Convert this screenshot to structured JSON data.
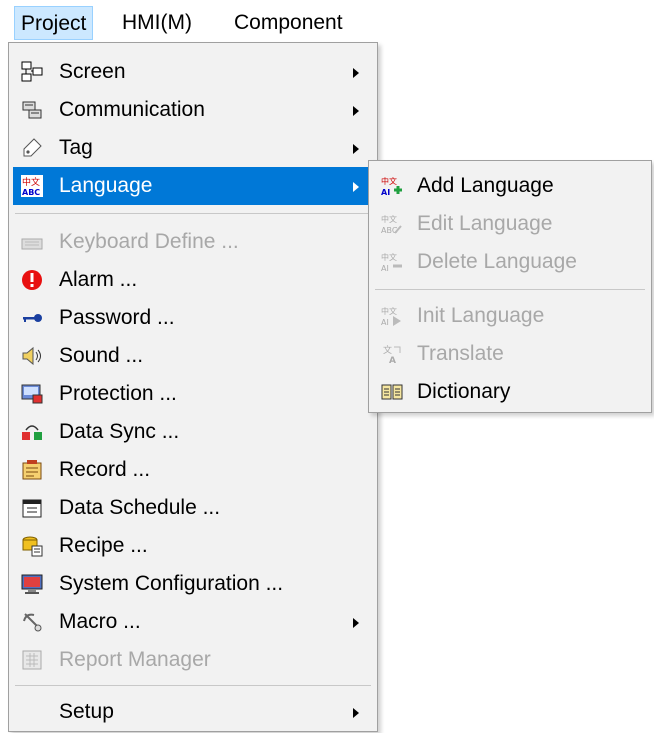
{
  "menubar": {
    "items": [
      {
        "label": "Project"
      },
      {
        "label": "HMI(M)"
      },
      {
        "label": "Component"
      }
    ]
  },
  "project_menu": {
    "items": [
      {
        "label": "Screen",
        "icon": "screen-icon",
        "submenu": true,
        "enabled": true
      },
      {
        "label": "Communication",
        "icon": "communication-icon",
        "submenu": true,
        "enabled": true
      },
      {
        "label": "Tag",
        "icon": "tag-icon",
        "submenu": true,
        "enabled": true
      },
      {
        "label": "Language",
        "icon": "language-icon",
        "submenu": true,
        "enabled": true,
        "selected": true
      },
      {
        "label": "Keyboard Define ...",
        "icon": "keyboard-icon",
        "submenu": false,
        "enabled": false
      },
      {
        "label": "Alarm ...",
        "icon": "alarm-icon",
        "submenu": false,
        "enabled": true
      },
      {
        "label": "Password ...",
        "icon": "key-icon",
        "submenu": false,
        "enabled": true
      },
      {
        "label": "Sound ...",
        "icon": "sound-icon",
        "submenu": false,
        "enabled": true
      },
      {
        "label": "Protection ...",
        "icon": "protection-icon",
        "submenu": false,
        "enabled": true
      },
      {
        "label": "Data Sync ...",
        "icon": "data-sync-icon",
        "submenu": false,
        "enabled": true
      },
      {
        "label": "Record ...",
        "icon": "record-icon",
        "submenu": false,
        "enabled": true
      },
      {
        "label": "Data Schedule ...",
        "icon": "data-schedule-icon",
        "submenu": false,
        "enabled": true
      },
      {
        "label": "Recipe ...",
        "icon": "recipe-icon",
        "submenu": false,
        "enabled": true
      },
      {
        "label": "System Configuration ...",
        "icon": "system-configuration-icon",
        "submenu": false,
        "enabled": true
      },
      {
        "label": "Macro ...",
        "icon": "macro-icon",
        "submenu": true,
        "enabled": true
      },
      {
        "label": "Report Manager",
        "icon": "report-manager-icon",
        "submenu": false,
        "enabled": false
      },
      {
        "label": "Setup",
        "icon": "",
        "submenu": true,
        "enabled": true
      }
    ]
  },
  "language_submenu": {
    "items": [
      {
        "label": "Add Language",
        "icon": "add-language-icon",
        "enabled": true
      },
      {
        "label": "Edit Language",
        "icon": "edit-language-icon",
        "enabled": false
      },
      {
        "label": "Delete Language",
        "icon": "delete-language-icon",
        "enabled": false
      },
      {
        "label": "Init Language",
        "icon": "init-language-icon",
        "enabled": false
      },
      {
        "label": "Translate",
        "icon": "translate-icon",
        "enabled": false
      },
      {
        "label": "Dictionary",
        "icon": "dictionary-icon",
        "enabled": true
      }
    ]
  },
  "colors": {
    "selection": "#0078d7",
    "menu_background": "#f2f2f2",
    "disabled_text": "#a8a8a8"
  }
}
